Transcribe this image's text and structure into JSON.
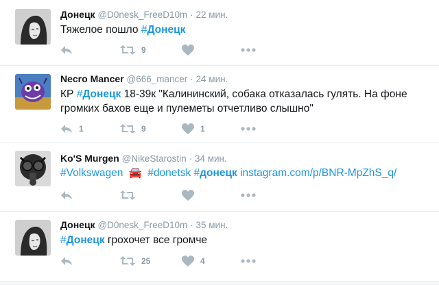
{
  "tweets": [
    {
      "name": "Донецк",
      "handle": "@D0nesk_FreeD10m",
      "dot": "·",
      "time": "22 мин.",
      "text_before": "Тяжелое пошло ",
      "hashtag": {
        "hash": "#",
        "tag": "Донецк"
      },
      "reply_count": "",
      "retweet_count": "9",
      "like_count": ""
    },
    {
      "name": "Necro Mancer",
      "handle": "@666_mancer",
      "dot": "·",
      "time": "24 мин.",
      "line1_before": "КР ",
      "hashtag": {
        "hash": "#",
        "tag": "Донецк"
      },
      "line1_after": " 18-39к \"Калининский, собака отказалась гулять. На фоне",
      "line2": "громких бахов еще и пулеметы отчетливо слышно\"",
      "reply_count": "1",
      "retweet_count": "9",
      "like_count": "1"
    },
    {
      "name": "Ko'S Murgen",
      "handle": "@NikeStarostin",
      "dot": "·",
      "time": "34 мин.",
      "hashtag1": {
        "hash": "#",
        "tag": "Volkswagen"
      },
      "car_emoji": "🚘",
      "hashtag2": {
        "hash": "#",
        "tag": "donetsk"
      },
      "hashtag3": {
        "hash": "#",
        "tag": "донецк"
      },
      "link": "instagram.com/p/BNR-MpZhS_q/",
      "reply_count": "",
      "retweet_count": "",
      "like_count": ""
    },
    {
      "name": "Донецк",
      "handle": "@D0nesk_FreeD10m",
      "dot": "·",
      "time": "35 мин.",
      "hashtag": {
        "hash": "#",
        "tag": "Донецк"
      },
      "text_after": " грохочет все громче",
      "reply_count": "",
      "retweet_count": "25",
      "like_count": "4"
    }
  ],
  "icons": {
    "reply": "reply-icon",
    "retweet": "retweet-icon",
    "like": "heart-icon",
    "more": "more-icon"
  },
  "colors": {
    "hashtag": "#1b95e0",
    "meta": "#8899a6",
    "icon": "#aab8c2",
    "divider": "#e6ecf0"
  }
}
